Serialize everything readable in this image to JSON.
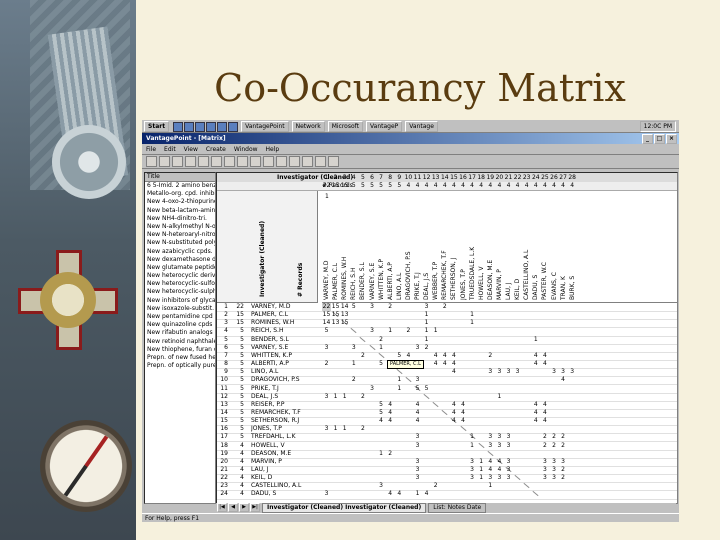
{
  "slide": {
    "title": "Co-Occurancy Matrix"
  },
  "taskbar": {
    "start_label": "Start",
    "buttons": [
      "VantagePoint",
      "Network",
      "Microsoft",
      "VantageP",
      "Vantage"
    ],
    "clock": "12:0C PM"
  },
  "window": {
    "title": "VantagePoint - [Matrix]"
  },
  "menu": [
    "File",
    "Edit",
    "View",
    "Create",
    "Window",
    "Help"
  ],
  "left_list": {
    "header": "Title",
    "items": [
      "6 5-Imid. 2 amino benzim",
      "Metallo-org. cpd. inhibit",
      "New 4-oxo-2-thiopurine",
      "New beta-lactam-amino",
      "New NH4-dinitro-tri.",
      "New N-alkylmethyl N-oxi",
      "New N-heteroaryl-nitro",
      "New N-substituted poly",
      "New azabicyclic cpds. u",
      "New dexamethasone deriv",
      "New glutamate peptide",
      "New heterocyclic deriva",
      "New heterocyclic-sulfon",
      "New heterocyclic-sulph",
      "New inhibitors of glycan",
      "New isoxazole-substit.",
      "New pentamidine cpd",
      "New quinazoline cpds",
      "New rifabutin analogs",
      "New retinoid naphthalene",
      "New thiophene, furan cp",
      "Prepn. of new fused hete",
      "Prepn. of optically pure"
    ]
  },
  "matrix": {
    "header_label": "Investigator (Cleaned)",
    "records_label": "# Records",
    "row_header_label": "Investigator (Cleaned)",
    "records_col_label": "# Records",
    "first_value": "1",
    "col_numbers": [
      "1",
      "2",
      "3",
      "4",
      "5",
      "6",
      "7",
      "8",
      "9",
      "10",
      "11",
      "12",
      "13",
      "14",
      "15",
      "16",
      "17",
      "18",
      "19",
      "20",
      "21",
      "22",
      "23",
      "24",
      "25",
      "26",
      "27",
      "28"
    ],
    "record_counts": [
      "22",
      "15",
      "15",
      "5",
      "5",
      "5",
      "5",
      "5",
      "5",
      "4",
      "4",
      "4",
      "4",
      "4",
      "4",
      "4",
      "4",
      "4",
      "4",
      "4",
      "4",
      "4",
      "4",
      "4",
      "4",
      "4",
      "4",
      "4"
    ],
    "col_names": [
      "VARNEY, M.D",
      "PALMER, C.L",
      "ROMINES, W.H",
      "REICH, S.H",
      "BENDER, S.L",
      "VARNEY, S.E",
      "WHITTEN, K.P",
      "ALBERTI, A.P",
      "LINO, A.L",
      "DRAGOVICH, P.S",
      "PRIKE, T.J",
      "DEAL, J.S",
      "WEBBER, T.P",
      "REMARCHEK, T.F",
      "SETHERSON, J",
      "JONES, T.P",
      "TRUEDSDALE, L.K",
      "HOWELL, V",
      "DEASON, M.E",
      "MARVIN, P",
      "LAU, J",
      "KEIL, D",
      "CASTELLINO, A.L",
      "DADU, S",
      "PASTER, W.C",
      "EVANS, C",
      "TRAN, K",
      "BURK, S"
    ],
    "tooltip": "PALMER, C.L",
    "rows": [
      {
        "n": "1",
        "id": "22",
        "name": "VARNEY, M.D",
        "cells": [
          "22",
          "15",
          "14",
          "5",
          "",
          "3",
          "",
          "2",
          "",
          "",
          "",
          "3",
          "",
          "2",
          "",
          "",
          "",
          "",
          "",
          "",
          "",
          "",
          "",
          "",
          "",
          "",
          "",
          ""
        ]
      },
      {
        "n": "2",
        "id": "15",
        "name": "PALMER, C.L",
        "cells": [
          "15",
          "15",
          "13",
          "",
          "",
          "",
          "",
          "",
          "",
          "",
          "",
          "1",
          "",
          "",
          "",
          "",
          "1",
          "",
          "",
          "",
          "",
          "",
          "",
          "",
          "",
          "",
          "",
          ""
        ]
      },
      {
        "n": "3",
        "id": "15",
        "name": "ROMINES, W.H",
        "cells": [
          "14",
          "13",
          "15",
          "",
          "",
          "",
          "",
          "",
          "",
          "",
          "",
          "1",
          "",
          "",
          "",
          "",
          "1",
          "",
          "",
          "",
          "",
          "",
          "",
          "",
          "",
          "",
          "",
          ""
        ]
      },
      {
        "n": "4",
        "id": "5",
        "name": "REICH, S.H",
        "cells": [
          "5",
          "",
          "",
          "",
          "",
          "3",
          "",
          "1",
          "",
          "2",
          "",
          "1",
          "1",
          "",
          "",
          "",
          "",
          "",
          "",
          "",
          "",
          "",
          "",
          "",
          "",
          "",
          "",
          ""
        ]
      },
      {
        "n": "5",
        "id": "5",
        "name": "BENDER, S.L",
        "cells": [
          "",
          "",
          "",
          "",
          "",
          "",
          "2",
          "",
          "",
          "",
          "",
          "1",
          "",
          "",
          "",
          "",
          "",
          "",
          "",
          "",
          "",
          "",
          "",
          "1",
          "",
          "",
          "",
          ""
        ]
      },
      {
        "n": "6",
        "id": "5",
        "name": "VARNEY, S.E",
        "cells": [
          "3",
          "",
          "",
          "3",
          "",
          "",
          "1",
          "",
          "",
          "",
          "3",
          "2",
          "",
          "",
          "",
          "",
          "",
          "",
          "",
          "",
          "",
          "",
          "",
          "",
          "",
          "",
          "",
          ""
        ]
      },
      {
        "n": "7",
        "id": "5",
        "name": "WHITTEN, K.P",
        "cells": [
          "",
          "",
          "",
          "",
          "2",
          "",
          "",
          "",
          "5",
          "4",
          "",
          "",
          "4",
          "4",
          "4",
          "",
          "",
          "",
          "2",
          "",
          "",
          "",
          "",
          "4",
          "4",
          "",
          "",
          ""
        ]
      },
      {
        "n": "8",
        "id": "5",
        "name": "ALBERTI, A.P",
        "cells": [
          "2",
          "",
          "",
          "1",
          "",
          "",
          "5",
          "",
          "",
          "4",
          "",
          "",
          "4",
          "4",
          "4",
          "",
          "",
          "",
          "",
          "",
          "",
          "",
          "",
          "4",
          "4",
          "",
          "",
          ""
        ]
      },
      {
        "n": "9",
        "id": "5",
        "name": "LINO, A.L",
        "cells": [
          "",
          "",
          "",
          "",
          "",
          "",
          "",
          "",
          "",
          "",
          "",
          "",
          "",
          "",
          "4",
          "",
          "",
          "",
          "3",
          "3",
          "3",
          "3",
          "",
          "",
          "",
          "3",
          "3",
          "3"
        ]
      },
      {
        "n": "10",
        "id": "5",
        "name": "DRAGOVICH, P.S",
        "cells": [
          "",
          "",
          "",
          "2",
          "",
          "",
          "",
          "",
          "1",
          "",
          "3",
          "",
          "",
          "",
          "",
          "",
          "",
          "",
          "",
          "",
          "",
          "",
          "",
          "",
          "",
          "",
          "4",
          ""
        ]
      },
      {
        "n": "11",
        "id": "5",
        "name": "PRIKE, T.J",
        "cells": [
          "",
          "",
          "",
          "",
          "",
          "3",
          "",
          "",
          "1",
          "",
          "5",
          "5",
          "",
          "",
          "",
          "",
          "",
          "",
          "",
          "",
          "",
          "",
          "",
          "",
          "",
          "",
          "",
          ""
        ]
      },
      {
        "n": "12",
        "id": "5",
        "name": "DEAL, J.S",
        "cells": [
          "3",
          "1",
          "1",
          "",
          "2",
          "",
          "",
          "",
          "",
          "",
          "",
          "",
          "",
          "",
          "",
          "",
          "",
          "",
          "",
          "1",
          "",
          "",
          "",
          "",
          "",
          "",
          "",
          ""
        ]
      },
      {
        "n": "13",
        "id": "5",
        "name": "REISER, P.P",
        "cells": [
          "",
          "",
          "",
          "",
          "",
          "",
          "5",
          "4",
          "",
          "",
          "4",
          "",
          "",
          "",
          "4",
          "4",
          "",
          "",
          "",
          "",
          "",
          "",
          "",
          "4",
          "4",
          "",
          "",
          ""
        ]
      },
      {
        "n": "14",
        "id": "5",
        "name": "REMARCHEK, T.F",
        "cells": [
          "",
          "",
          "",
          "",
          "",
          "",
          "5",
          "4",
          "",
          "",
          "4",
          "",
          "",
          "",
          "4",
          "4",
          "",
          "",
          "",
          "",
          "",
          "",
          "",
          "4",
          "4",
          "",
          "",
          ""
        ]
      },
      {
        "n": "15",
        "id": "5",
        "name": "SETHERSON, R.J",
        "cells": [
          "",
          "",
          "",
          "",
          "",
          "",
          "4",
          "4",
          "",
          "",
          "4",
          "",
          "",
          "",
          "4",
          "4",
          "",
          "",
          "",
          "",
          "",
          "",
          "",
          "4",
          "4",
          "",
          "",
          ""
        ]
      },
      {
        "n": "16",
        "id": "5",
        "name": "JONES, T.P",
        "cells": [
          "3",
          "1",
          "1",
          "",
          "2",
          "",
          "",
          "",
          "",
          "",
          "",
          "",
          "",
          "",
          "",
          "",
          "",
          "",
          "",
          "",
          "",
          "",
          "",
          "",
          "",
          "",
          "",
          ""
        ]
      },
      {
        "n": "17",
        "id": "5",
        "name": "TREFDAHL, L.K",
        "cells": [
          "",
          "",
          "",
          "",
          "",
          "",
          "",
          "",
          "",
          "",
          "3",
          "",
          "",
          "",
          "",
          "",
          "1",
          "",
          "3",
          "3",
          "3",
          "",
          "",
          "",
          "2",
          "2",
          "2",
          ""
        ]
      },
      {
        "n": "18",
        "id": "4",
        "name": "HOWELL, V",
        "cells": [
          "",
          "",
          "",
          "",
          "",
          "",
          "",
          "",
          "",
          "",
          "3",
          "",
          "",
          "",
          "",
          "",
          "1",
          "",
          "3",
          "3",
          "3",
          "",
          "",
          "",
          "2",
          "2",
          "2",
          ""
        ]
      },
      {
        "n": "19",
        "id": "4",
        "name": "DEASON, M.E",
        "cells": [
          "",
          "",
          "",
          "",
          "",
          "",
          "1",
          "2",
          "",
          "",
          "",
          "",
          "",
          "",
          "",
          "",
          "",
          "",
          "",
          "",
          "",
          "",
          "",
          "",
          "",
          "",
          "",
          ""
        ]
      },
      {
        "n": "20",
        "id": "4",
        "name": "MARVIN, P",
        "cells": [
          "",
          "",
          "",
          "",
          "",
          "",
          "",
          "",
          "",
          "",
          "3",
          "",
          "",
          "",
          "",
          "",
          "3",
          "1",
          "4",
          "4",
          "3",
          "",
          "",
          "",
          "3",
          "3",
          "3",
          ""
        ]
      },
      {
        "n": "21",
        "id": "4",
        "name": "LAU, J",
        "cells": [
          "",
          "",
          "",
          "",
          "",
          "",
          "",
          "",
          "",
          "",
          "3",
          "",
          "",
          "",
          "",
          "",
          "3",
          "1",
          "4",
          "4",
          "3",
          "",
          "",
          "",
          "3",
          "3",
          "2",
          ""
        ]
      },
      {
        "n": "22",
        "id": "4",
        "name": "KEIL, D",
        "cells": [
          "",
          "",
          "",
          "",
          "",
          "",
          "",
          "",
          "",
          "",
          "3",
          "",
          "",
          "",
          "",
          "",
          "3",
          "1",
          "3",
          "3",
          "3",
          "",
          "",
          "",
          "3",
          "3",
          "2",
          ""
        ]
      },
      {
        "n": "23",
        "id": "4",
        "name": "CASTELLINO, A.L",
        "cells": [
          "",
          "",
          "",
          "",
          "",
          "",
          "3",
          "",
          "",
          "",
          "",
          "",
          "2",
          "",
          "",
          "",
          "",
          "",
          "1",
          "",
          "",
          "",
          "",
          "",
          "",
          "",
          "",
          ""
        ]
      },
      {
        "n": "24",
        "id": "4",
        "name": "DADU, S",
        "cells": [
          "3",
          "",
          "",
          "",
          "",
          "",
          "",
          "4",
          "4",
          "",
          "1",
          "4",
          "",
          "",
          "",
          "",
          "",
          "",
          "",
          "",
          "",
          "",
          "",
          "",
          "",
          "",
          "",
          ""
        ]
      }
    ]
  },
  "tabs": [
    "Investigator (Cleaned) Investigator (Cleaned)",
    "List: Notes Date"
  ],
  "status": "For Help, press F1"
}
